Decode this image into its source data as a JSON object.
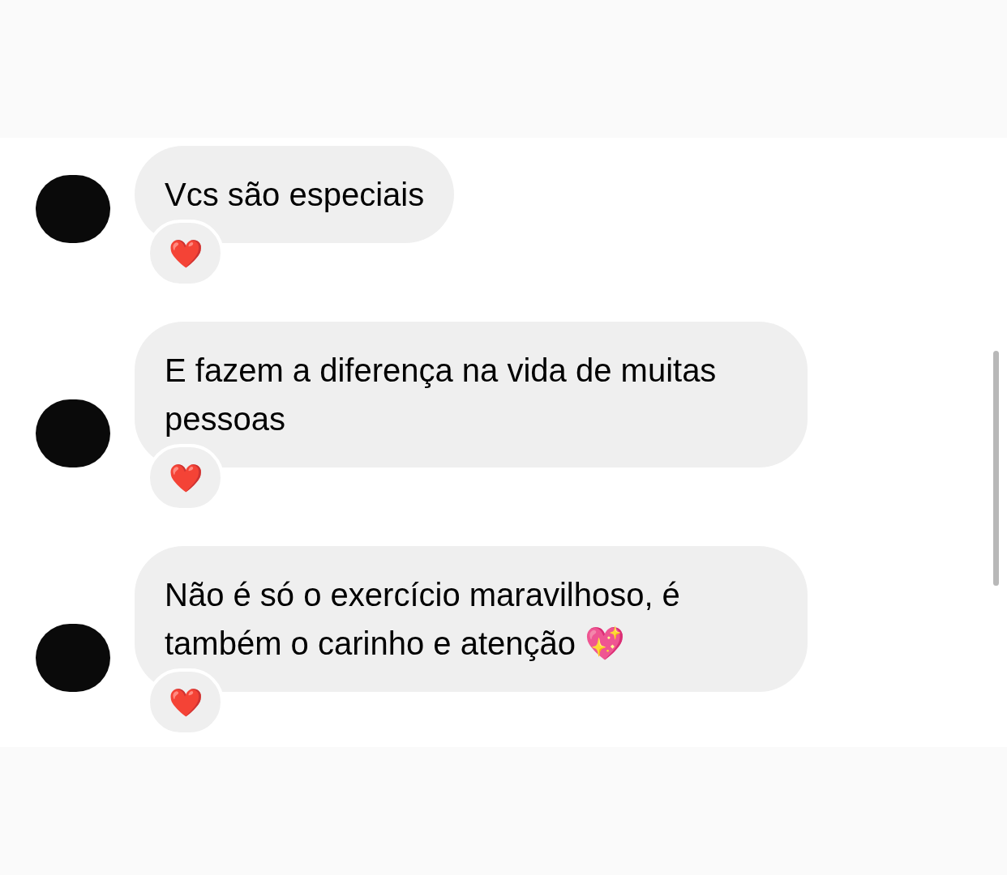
{
  "messages": [
    {
      "text": "Vcs são especiais",
      "reaction": "❤️"
    },
    {
      "text": "E fazem a diferença na vida de muitas pessoas",
      "reaction": "❤️"
    },
    {
      "text": "Não é só o exercício maravilhoso, é também o carinho e atenção 💖",
      "reaction": "❤️"
    }
  ]
}
